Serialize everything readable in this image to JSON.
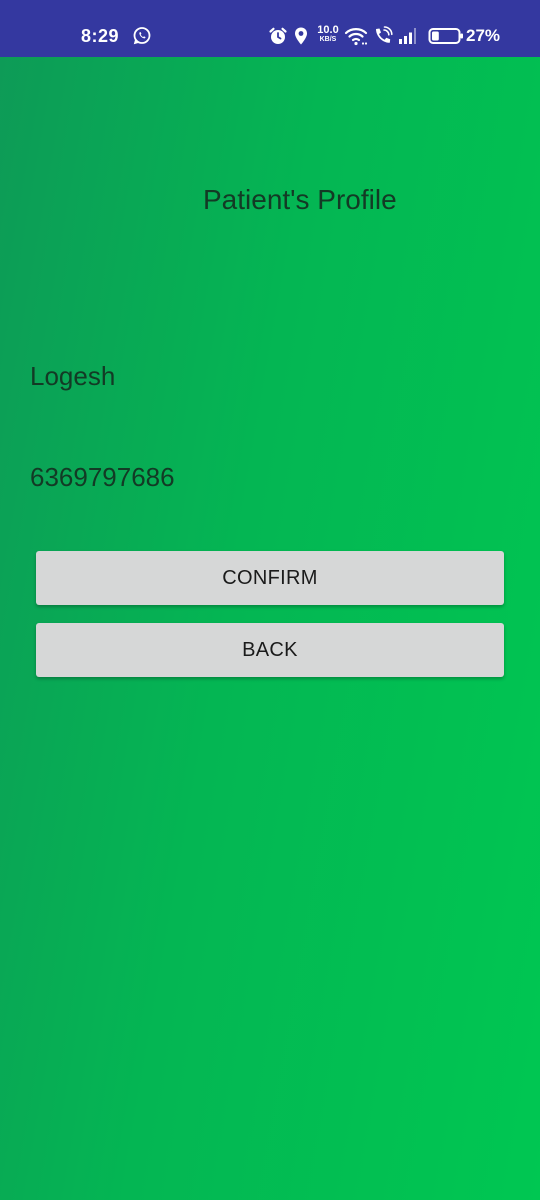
{
  "status_bar": {
    "time": "8:29",
    "net_speed_value": "10.0",
    "net_speed_unit": "KB/S",
    "battery_percent": "27%",
    "battery_level": 0.27,
    "icons": [
      "whatsapp-icon",
      "alarm-icon",
      "location-icon",
      "wifi-icon",
      "wifi-calling-icon",
      "signal-icon",
      "battery-icon"
    ],
    "background_color": "#3438a0"
  },
  "page": {
    "title": "Patient's Profile",
    "gradient_start": "#0e9a57",
    "gradient_end": "#00c752"
  },
  "patient": {
    "name": "Logesh",
    "phone": "6369797686"
  },
  "buttons": {
    "confirm_label": "CONFIRM",
    "back_label": "BACK"
  }
}
